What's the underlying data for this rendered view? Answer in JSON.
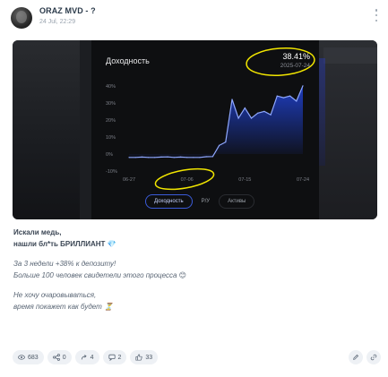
{
  "post": {
    "author": "ORAZ MVD - ?",
    "date": "24 Jul, 22:29"
  },
  "screenshot": {
    "title": "Доходность",
    "value": "38.41%",
    "date": "2025-07-24",
    "tabs": [
      "Доходность",
      "P/У",
      "Активы"
    ],
    "active_tab": "Доходность",
    "line_color": "#8fa8ff",
    "fill_color": "#1f3fc7",
    "annotation_color": "#f2e600"
  },
  "chart_data": {
    "type": "area",
    "x": [
      "06-27",
      "06-28",
      "06-29",
      "06-30",
      "07-01",
      "07-02",
      "07-03",
      "07-04",
      "07-05",
      "07-06",
      "07-07",
      "07-08",
      "07-09",
      "07-10",
      "07-11",
      "07-12",
      "07-13",
      "07-14",
      "07-15",
      "07-16",
      "07-17",
      "07-18",
      "07-19",
      "07-20",
      "07-21",
      "07-22",
      "07-23",
      "07-24"
    ],
    "values": [
      -2,
      -2,
      -1.8,
      -2,
      -2,
      -1.8,
      -1.7,
      -2,
      -1.8,
      -2,
      -2,
      -2,
      -1.6,
      -1.5,
      5,
      7,
      32,
      21,
      27,
      21,
      24,
      25,
      23,
      34,
      33,
      34,
      31,
      40
    ],
    "xticks": [
      "06-27",
      "07-06",
      "07-15",
      "07-24"
    ],
    "yticks": [
      "40%",
      "30%",
      "20%",
      "10%",
      "0%",
      "-10%"
    ],
    "ylim": [
      -10,
      42
    ]
  },
  "text": {
    "line1": "Искали медь,",
    "line2": "нашли бл*ть БРИЛЛИАНТ 💎",
    "line3": "За 3 недели +38% к депозиту!",
    "line4": "Больше 100 человек свидетели этого процесса 😊",
    "line5": "Не хочу очаровываться,",
    "line6": "время покажет как будет ⏳"
  },
  "stats": {
    "views": "683",
    "shares": "0",
    "reposts": "4",
    "comments": "2",
    "likes": "33"
  }
}
